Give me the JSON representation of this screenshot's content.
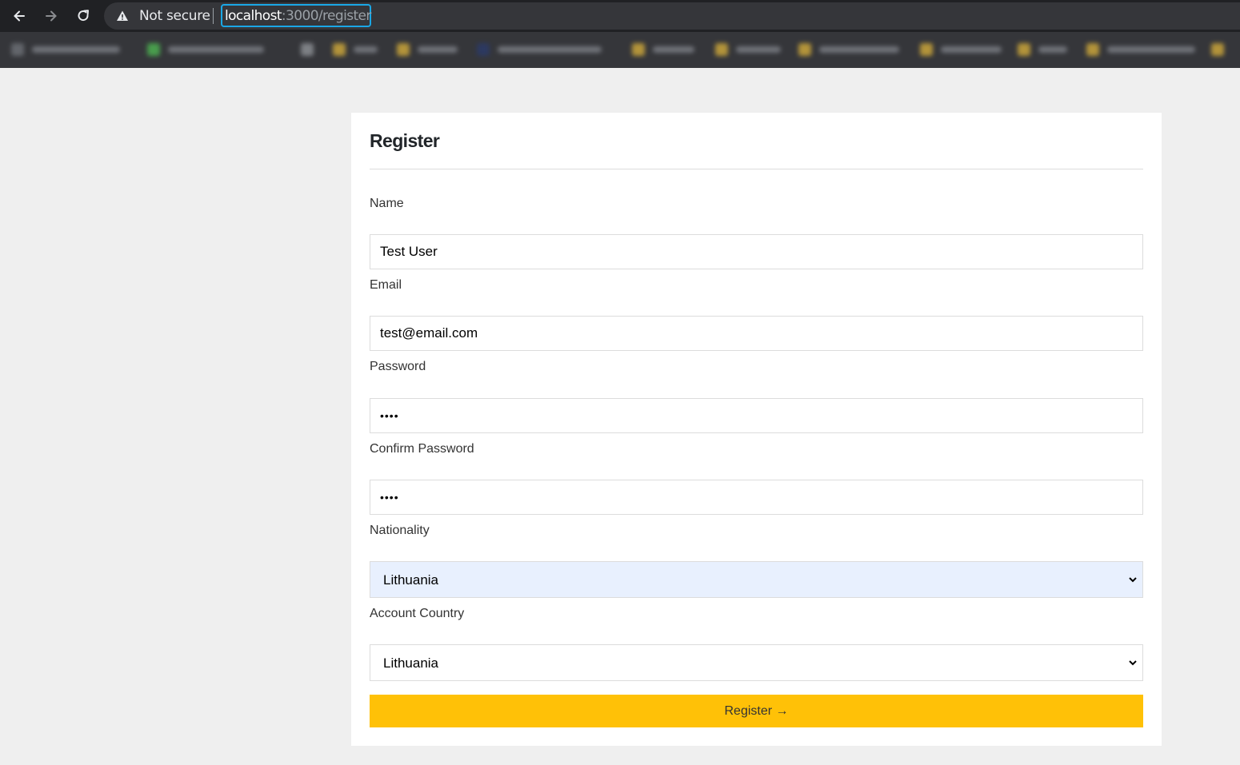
{
  "browser": {
    "security_label": "Not secure",
    "url_host": "localhost",
    "url_path": ":3000/register",
    "accent_color": "#1aa7e6"
  },
  "form": {
    "title": "Register",
    "name": {
      "label": "Name",
      "value": "Test User"
    },
    "email": {
      "label": "Email",
      "value": "test@email.com"
    },
    "password": {
      "label": "Password",
      "value": "1234"
    },
    "confirm_password": {
      "label": "Confirm Password",
      "value": "1234"
    },
    "nationality": {
      "label": "Nationality",
      "selected": "Lithuania"
    },
    "account_country": {
      "label": "Account Country",
      "selected": "Lithuania"
    },
    "submit_label": "Register →",
    "submit_color": "#ffc107"
  }
}
